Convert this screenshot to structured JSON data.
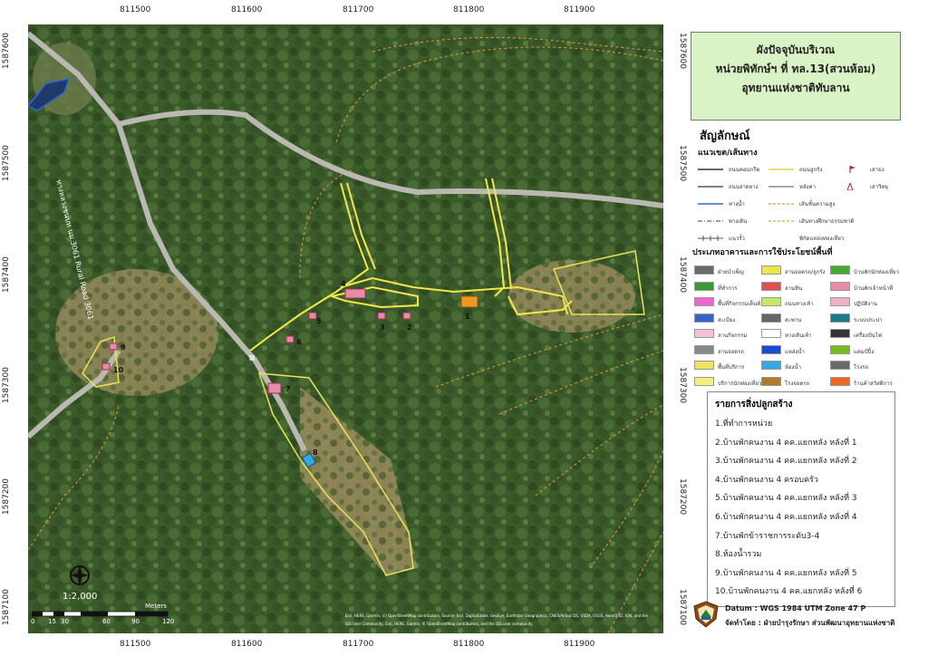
{
  "grid": {
    "x_labels": [
      "811500",
      "811600",
      "811700",
      "811800",
      "811900"
    ],
    "y_labels": [
      "1587600",
      "1587500",
      "1587400",
      "1587300",
      "1587200",
      "1587100"
    ]
  },
  "map": {
    "road_label": "ทางหลวงชนบท นม.3061 Rural Road 3061",
    "scale_text": "1:2,000",
    "scale_unit": "Meters",
    "scale_ticks": [
      "0",
      "15",
      "30",
      "60",
      "90",
      "120"
    ],
    "attribution_1": "Esri, HERE, Garmin, (c) OpenStreetMap contributors, Source: Esri, DigitalGlobe, GeoEye, Earthstar Geographics, CNES/Airbus DS, USDA, USGS, AeroGRID, IGN, and the",
    "attribution_2": "GIS User Community, Esri, HERE, Garmin, © OpenStreetMap contributors, and the GIS user community",
    "building_markers": [
      "1",
      "2",
      "3",
      "4",
      "5",
      "6",
      "7",
      "8",
      "9",
      "10"
    ],
    "colors": {
      "trail": "#f2e84a",
      "zone": "#e8e45a",
      "contour": "#e09a3a",
      "road": "#b0b0b0",
      "water": "#2c6ad0",
      "forest_dark": "#2f4a22",
      "forest_mid": "#4a6b33",
      "clearing": "#a89a6a"
    }
  },
  "legend": {
    "title_1": "ผังปัจจุบันบริเวณ",
    "title_2": "หน่วยพิทักษ์ฯ ที่ ทล.13(สวนห้อม)",
    "title_3": "อุทยานแห่งชาติทับลาน",
    "symbols_heading": "สัญลักษณ์",
    "boundary_heading": "แนวเขต/เส้นทาง",
    "boundary_items": [
      {
        "label": "ถนนคอนกรีต",
        "color": "#333333",
        "style": "solid"
      },
      {
        "label": "ถนนลาดยาง",
        "color": "#555555",
        "style": "solid"
      },
      {
        "label": "ทางน้ำ",
        "color": "#2c6ad0",
        "style": "solid"
      },
      {
        "label": "ทางเดิน",
        "color": "#666666",
        "style": "dashdot"
      },
      {
        "label": "แนวรั้ว",
        "color": "#555555",
        "style": "fence"
      },
      {
        "label": "ถนนลูกรัง",
        "color": "#e8d34a",
        "style": "solid"
      },
      {
        "label": "หลังคา",
        "color": "#888888",
        "style": "solid"
      },
      {
        "label": "เส้นชั้นความสูง",
        "color": "#e09a3a",
        "style": "dashed"
      },
      {
        "label": "เส้นทางศึกษาธรรมชาติ",
        "color": "#9acd32",
        "style": "dashed"
      },
      {
        "label": "พิกัดแหล่งท่องเที่ยว",
        "color": "#777777",
        "style": "none"
      },
      {
        "label": "เสาธง",
        "color": "#cc2222",
        "style": "flag"
      },
      {
        "label": "เสาวิทยุ",
        "color": "#cc2222",
        "style": "radio"
      }
    ],
    "landuse_heading": "ประเภทอาคารและการใช้ประโยชน์พื้นที่",
    "landuse_items": [
      {
        "label": "ฝ่ายบำเพ็ญ",
        "color": "#6b6b6b"
      },
      {
        "label": "ลานจอดรถ/ลูกรัง",
        "color": "#e8e84a"
      },
      {
        "label": "บ้านพักนักท่องเที่ยว",
        "color": "#44aa33"
      },
      {
        "label": "ที่ทำการ",
        "color": "#3a9a3a"
      },
      {
        "label": "ลานหิน",
        "color": "#e05050"
      },
      {
        "label": "บ้านพักเจ้าหน้าที่",
        "color": "#e88aa8"
      },
      {
        "label": "พื้นที่กิจกรรมเต็นท์",
        "color": "#ee66cc"
      },
      {
        "label": "ถนนทางเท้า",
        "color": "#c8e86a"
      },
      {
        "label": "ปฏิบัติงาน",
        "color": "#f0b0c0"
      },
      {
        "label": "สะเบียง",
        "color": "#3366cc"
      },
      {
        "label": "สะพาน",
        "color": "#666666"
      },
      {
        "label": "ระบบประปา",
        "color": "#1a7a8a"
      },
      {
        "label": "ลานกิจกรรม",
        "color": "#f4c0d8"
      },
      {
        "label": "ทางเดินเท้า",
        "color": "#ffffff"
      },
      {
        "label": "เครื่องปั่นไฟ",
        "color": "#333333"
      },
      {
        "label": "ลานจอดรถ",
        "color": "#888888"
      },
      {
        "label": "แหล่งน้ำ",
        "color": "#1a4ad0"
      },
      {
        "label": "แคมป์ปิ้ง",
        "color": "#77bb22"
      },
      {
        "label": "พื้นที่บริการ",
        "color": "#f0e060"
      },
      {
        "label": "ห้องน้ำ",
        "color": "#33aadd"
      },
      {
        "label": "โรงรถ",
        "color": "#6a6a6a"
      },
      {
        "label": "บริการนักท่องเที่ยว",
        "color": "#f4f080"
      },
      {
        "label": "โรงจอดรถ",
        "color": "#b07a2a"
      },
      {
        "label": "ร้านค้าสวัสดิการ",
        "color": "#ee6622"
      }
    ],
    "buildings_heading": "รายการสิ่งปลูกสร้าง",
    "buildings": [
      "1.ที่ทำการหน่วย",
      "2.บ้านพักคนงาน 4 คค.แยกหลัง หลังที่ 1",
      "3.บ้านพักคนงาน 4 คค.แยกหลัง หลังที่ 2",
      "4.บ้านพักคนงาน 4 ครอบครัว",
      "5.บ้านพักคนงาน 4 คค.แยกหลัง หลังที่ 3",
      "6.บ้านพักคนงาน 4 คค.แยกหลัง หลังที่ 4",
      "7.บ้านพักข้าราชการระดับ3-4",
      "8.ห้องน้ำรวม",
      "9.บ้านพักคนงาน 4 คค.แยกหลัง หลังที่ 5",
      "10.บ้านพักคนงาน 4 คค.แยกหลัง หลังที่ 6"
    ],
    "datum": "Datum : WGS 1984 UTM Zone 47 P",
    "made_by": "จัดทำโดย : ฝ่ายบำรุงรักษา ส่วนพัฒนาอุทยานแห่งชาติ"
  }
}
